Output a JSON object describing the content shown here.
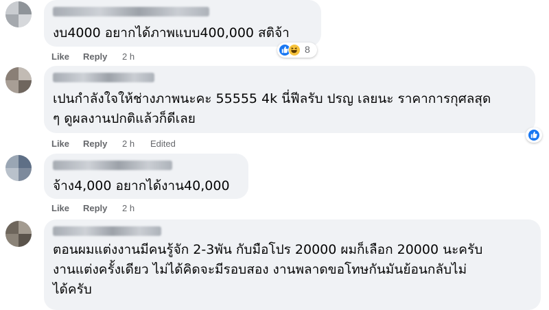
{
  "actions": {
    "like": "Like",
    "reply": "Reply"
  },
  "comments": [
    {
      "text": "งบ4000 อยากได้ภาพแบบ400,000 สติจ้า",
      "time": "2 h",
      "edited": "",
      "reaction_count": "8"
    },
    {
      "text": "เปนกำลังใจให้ช่างภาพนะคะ 55555 4k นี่ฟีลรับ ปรญ เลยนะ ราคาการกุศลสุด\nๆ ดูผลงานปกติแล้วก็ดีเลย",
      "time": "2 h",
      "edited": "Edited",
      "reaction_count": ""
    },
    {
      "text": "จ้าง4,000 อยากได้งาน40,000",
      "time": "2 h",
      "edited": "",
      "reaction_count": ""
    },
    {
      "text": "ตอนผมแต่งงานมีคนรู้จัก 2-3พัน กับมือโปร 20000 ผมก็เลือก 20000 นะครับ\nงานแต่งครั้งเดียว ไม่ได้คิดจะมีรอบสอง งานพลาดขอโทษกันมันย้อนกลับไม่\nได้ครับ",
      "time": "",
      "edited": "",
      "reaction_count": ""
    }
  ],
  "colors": {
    "bubble": "#f0f2f5",
    "meta": "#65676b",
    "like_blue": "#1877f2",
    "haha_yellow": "#f7c33d"
  }
}
